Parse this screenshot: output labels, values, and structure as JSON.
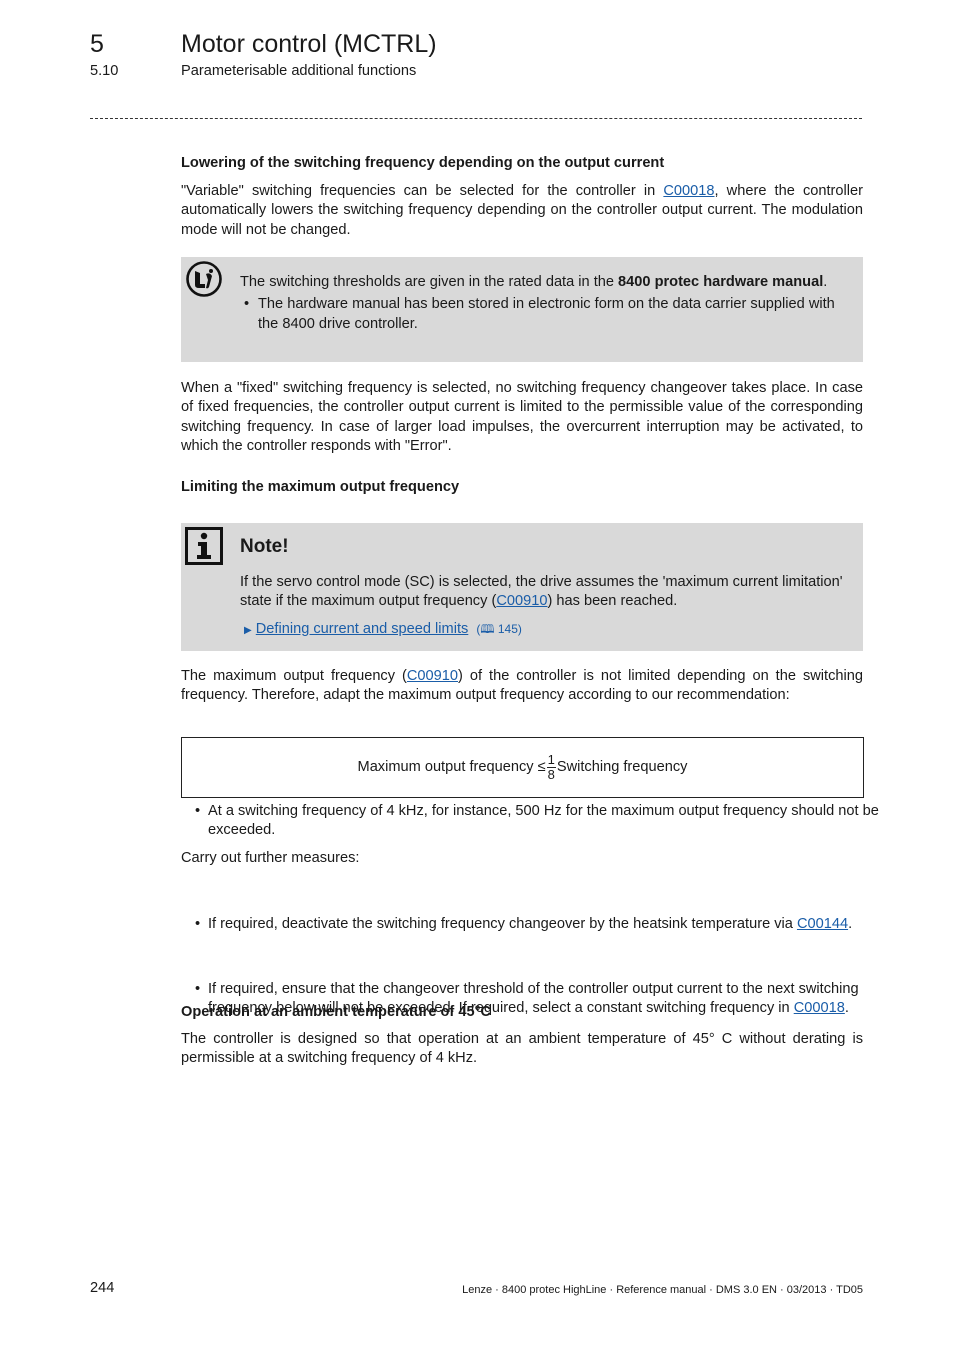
{
  "header": {
    "chapter_number": "5",
    "chapter_title": "Motor control (MCTRL)",
    "section_number": "5.10",
    "section_title": "Parameterisable additional functions"
  },
  "section1": {
    "heading": "Lowering of the switching frequency depending on the output current",
    "para_before": "\"Variable\" switching frequencies can be selected for the controller in ",
    "para_link": "C00018",
    "para_after": ", where the controller automatically lowers the switching frequency depending on the controller output current. The modulation mode will not be changed."
  },
  "tip_box": {
    "icon": "tip-hand-icon",
    "text_before": "The switching thresholds are given in the rated data in the ",
    "text_bold": "8400 protec hardware manual",
    "text_after": ".",
    "bullet": "The hardware manual has been stored in electronic form on the data carrier supplied with the 8400 drive controller."
  },
  "para_fixed": "When a \"fixed\" switching frequency is selected, no switching frequency changeover takes place. In case of fixed frequencies, the controller output current is limited to the permissible value of the corresponding switching frequency. In case of larger load impulses, the overcurrent interruption may be activated, to which the controller responds with \"Error\".",
  "section2": {
    "heading": "Limiting the maximum output frequency"
  },
  "note_box": {
    "icon": "info-icon",
    "title": "Note!",
    "text_before": "If the servo control mode (SC) is selected, the drive assumes the 'maximum current limitation' state if the maximum output frequency (",
    "text_link": "C00910",
    "text_after": ") has been reached.",
    "xref_label": "Defining current and speed limits",
    "xref_page": "145"
  },
  "para_max": {
    "before": "The maximum output frequency (",
    "link": "C00910",
    "after": ") of the controller is not limited depending on the switching frequency. Therefore, adapt the maximum output frequency according to our recommendation:"
  },
  "formula": {
    "left": "Maximum output frequency ≤ ",
    "numerator": "1",
    "denominator": "8",
    "right": "Switching frequency"
  },
  "bullet_example": "At a switching frequency of 4 kHz, for instance, 500 Hz for the maximum output frequency should not be exceeded.",
  "measures_intro": "Carry out further measures:",
  "measures": [
    {
      "before": "If required, deactivate the switching frequency changeover by the heatsink temperature via ",
      "link": "C00144",
      "after": "."
    },
    {
      "before": "If required, ensure that the changeover threshold of the controller output current to the next switching frequency below will not be exceeded. If required, select a constant switching frequency in ",
      "link": "C00018",
      "after": "."
    }
  ],
  "section3": {
    "heading": "Operation at an ambient temperature of 45°C",
    "para": "The controller is designed so that operation at an ambient temperature of 45° C without derating is permissible at a switching frequency of 4 kHz."
  },
  "footer": {
    "page_number": "244",
    "text": "Lenze · 8400 protec HighLine · Reference manual · DMS 3.0 EN · 03/2013 · TD05"
  }
}
